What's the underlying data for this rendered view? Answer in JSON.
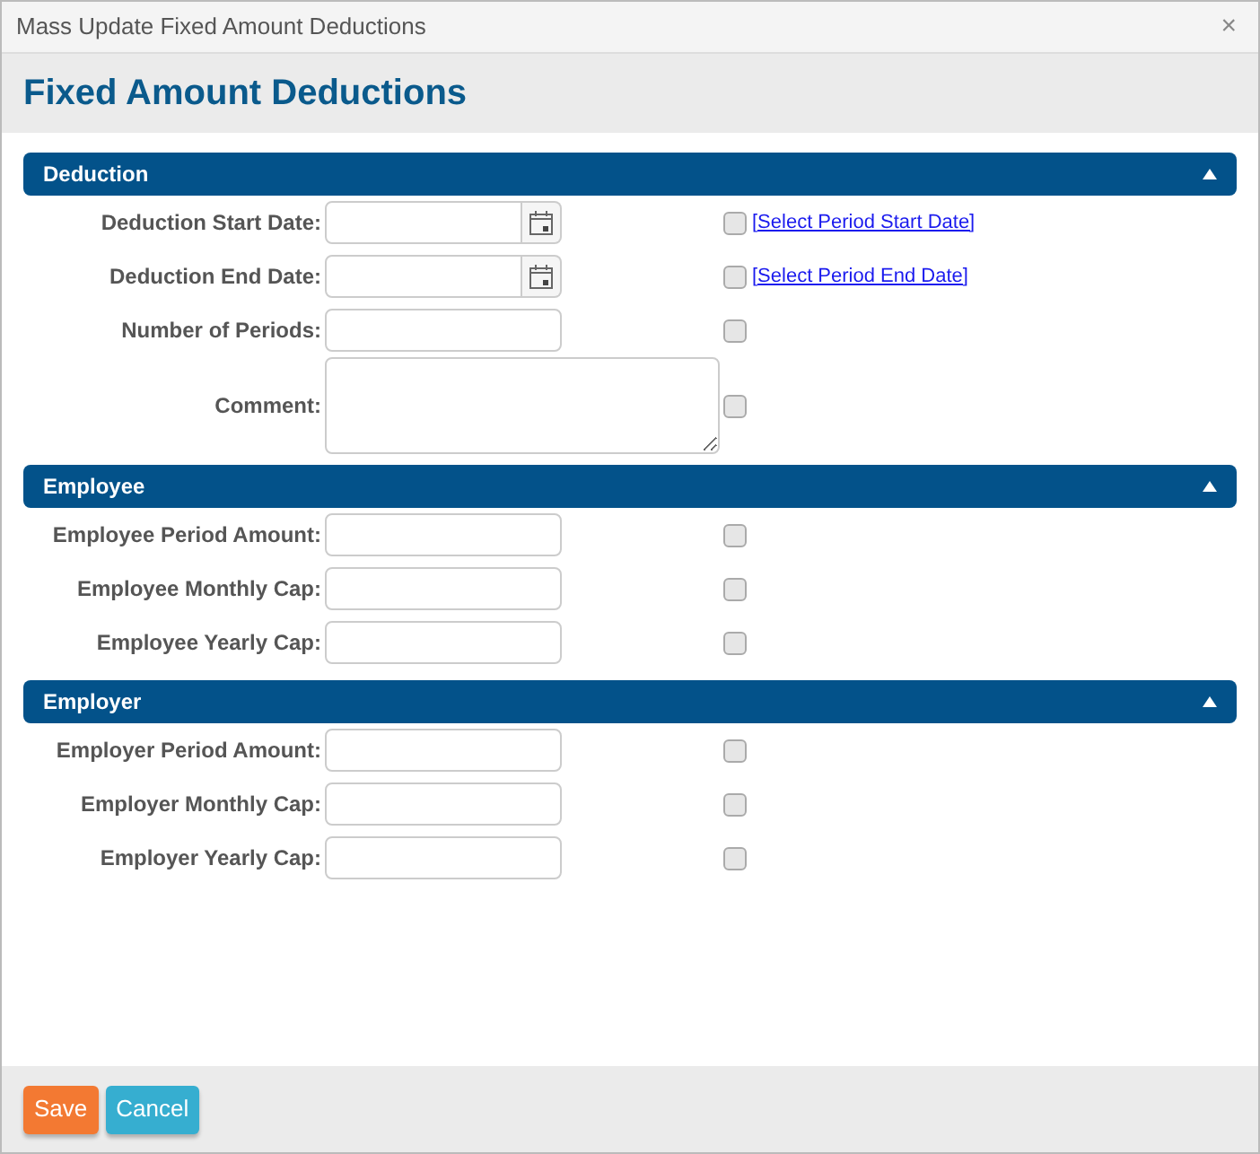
{
  "window": {
    "title": "Mass Update Fixed Amount Deductions",
    "close": "×"
  },
  "heading": "Fixed Amount Deductions",
  "sections": [
    {
      "title": "Deduction",
      "expanded": true,
      "fields": [
        {
          "label": "Deduction Start Date:",
          "kind": "date",
          "checked": false,
          "link": "[Select Period Start Date]"
        },
        {
          "label": "Deduction End Date:",
          "kind": "date",
          "checked": false,
          "link": "[Select Period End Date]"
        },
        {
          "label": "Number of Periods:",
          "kind": "text",
          "checked": false
        },
        {
          "label": "Comment:",
          "kind": "textarea",
          "checked": false
        }
      ]
    },
    {
      "title": "Employee",
      "expanded": true,
      "fields": [
        {
          "label": "Employee Period Amount:",
          "kind": "text",
          "checked": false
        },
        {
          "label": "Employee Monthly Cap:",
          "kind": "text",
          "checked": false
        },
        {
          "label": "Employee Yearly Cap:",
          "kind": "text",
          "checked": false
        }
      ]
    },
    {
      "title": "Employer",
      "expanded": true,
      "fields": [
        {
          "label": "Employer Period Amount:",
          "kind": "text",
          "checked": false
        },
        {
          "label": "Employer Monthly Cap:",
          "kind": "text",
          "checked": false
        },
        {
          "label": "Employer Yearly Cap:",
          "kind": "text",
          "checked": false
        }
      ]
    }
  ],
  "buttons": [
    {
      "label": "Save",
      "kind": "primary"
    },
    {
      "label": "Cancel",
      "kind": "secondary"
    }
  ]
}
